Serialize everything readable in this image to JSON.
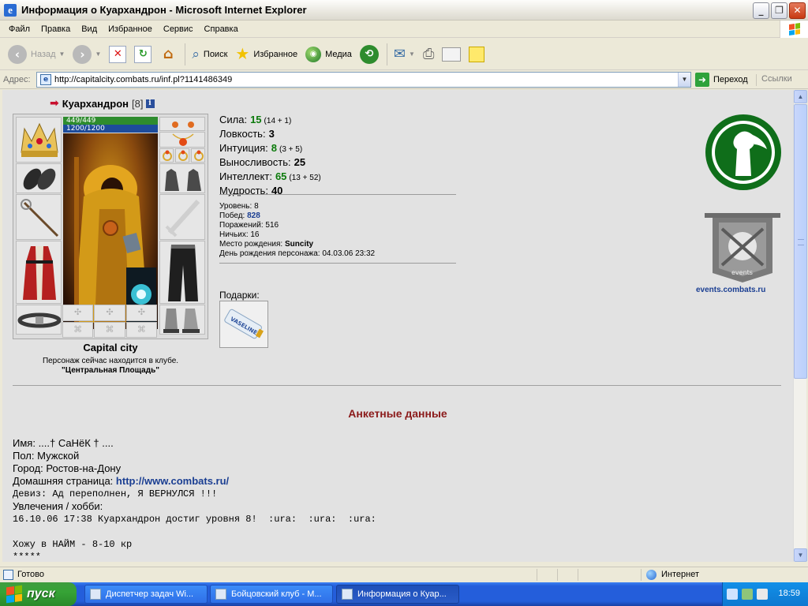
{
  "window": {
    "title": "Информация о Куархандрон - Microsoft Internet Explorer"
  },
  "menu": [
    "Файл",
    "Правка",
    "Вид",
    "Избранное",
    "Сервис",
    "Справка"
  ],
  "toolbar": {
    "back": "Назад",
    "search": "Поиск",
    "favorites": "Избранное",
    "media": "Медиа"
  },
  "address": {
    "label": "Адрес:",
    "url": "http://capitalcity.combats.ru/inf.pl?1141486349",
    "go": "Переход",
    "links": "Ссылки"
  },
  "character": {
    "name": "Куархандрон",
    "level": "[8]",
    "hp": "449/449",
    "mana": "1200/1200",
    "city": "Capital city",
    "club_note": "Персонаж сейчас находится в клубе.",
    "club_location": "\"Центральная Площадь\""
  },
  "stats": [
    {
      "label": "Сила:",
      "value": "15",
      "extra": "(14 + 1)",
      "green": true
    },
    {
      "label": "Ловкость:",
      "value": "3",
      "extra": "",
      "green": false
    },
    {
      "label": "Интуиция:",
      "value": "8",
      "extra": "(3 + 5)",
      "green": true
    },
    {
      "label": "Выносливость:",
      "value": "25",
      "extra": "",
      "green": false
    },
    {
      "label": "Интеллект:",
      "value": "65",
      "extra": "(13 + 52)",
      "green": true
    },
    {
      "label": "Мудрость:",
      "value": "40",
      "extra": "",
      "green": false
    }
  ],
  "info": {
    "level_label": "Уровень:",
    "level": "8",
    "wins_label": "Побед:",
    "wins": "828",
    "losses_label": "Поражений:",
    "losses": "516",
    "draws_label": "Ничьих:",
    "draws": "16",
    "birthplace_label": "Место рождения:",
    "birthplace": "Suncity",
    "birthday_label": "День рождения персонажа:",
    "birthday": "04.03.06 23:32"
  },
  "gifts": {
    "title": "Подарки:",
    "item_text": "VASELINE"
  },
  "events": {
    "badge_text": "events",
    "link": "events.combats.ru"
  },
  "anketa": {
    "title": "Анкетные данные",
    "name_label": "Имя:",
    "name": "....† СаНёК † ....",
    "sex_label": "Пол:",
    "sex": "Мужской",
    "city_label": "Город:",
    "city": "Ростов-на-Дону",
    "homepage_label": "Домашняя страница:",
    "homepage": "http://www.combats.ru/",
    "motto_label": "Девиз:",
    "motto": "Ад переполнен, Я ВЕРНУЛСЯ !!!",
    "hobby_label": "Увлечения / хобби:",
    "line1": "16.10.06 17:38 Куархандрон достиг уровня 8!  :ura:  :ura:  :ura:",
    "line2": "Хожу в НАЙМ - 8-10 кр",
    "line3": "*****"
  },
  "status": {
    "text": "Готово",
    "zone": "Интернет"
  },
  "taskbar": {
    "start": "пуск",
    "tasks": [
      "Диспетчер задач Wi...",
      "Бойцовский клуб - M...",
      "Информация о Куар..."
    ],
    "clock": "18:59"
  }
}
